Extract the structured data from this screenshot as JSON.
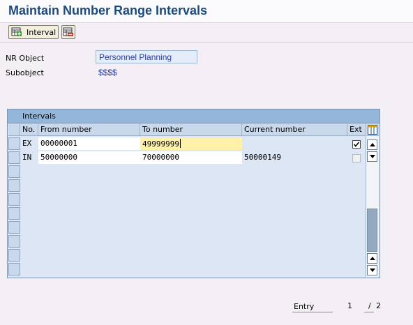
{
  "window": {
    "title": "Maintain Number Range Intervals"
  },
  "toolbar": {
    "interval_label": "Interval"
  },
  "header": {
    "nr_object_label": "NR Object",
    "nr_object_value": "Personnel Planning",
    "subobject_label": "Subobject",
    "subobject_value": "$$$$"
  },
  "intervals": {
    "title": "Intervals",
    "columns": [
      "No.",
      "From number",
      "To number",
      "Current number",
      "Ext"
    ],
    "rows": [
      {
        "no": "EX",
        "from": "00000001",
        "to": "49999999",
        "current": "",
        "ext": true
      },
      {
        "no": "IN",
        "from": "50000000",
        "to": "70000000",
        "current": "50000149",
        "ext": false
      }
    ]
  },
  "footer": {
    "entry_label": "Entry",
    "current": "1",
    "separator": "/",
    "total": "2"
  }
}
